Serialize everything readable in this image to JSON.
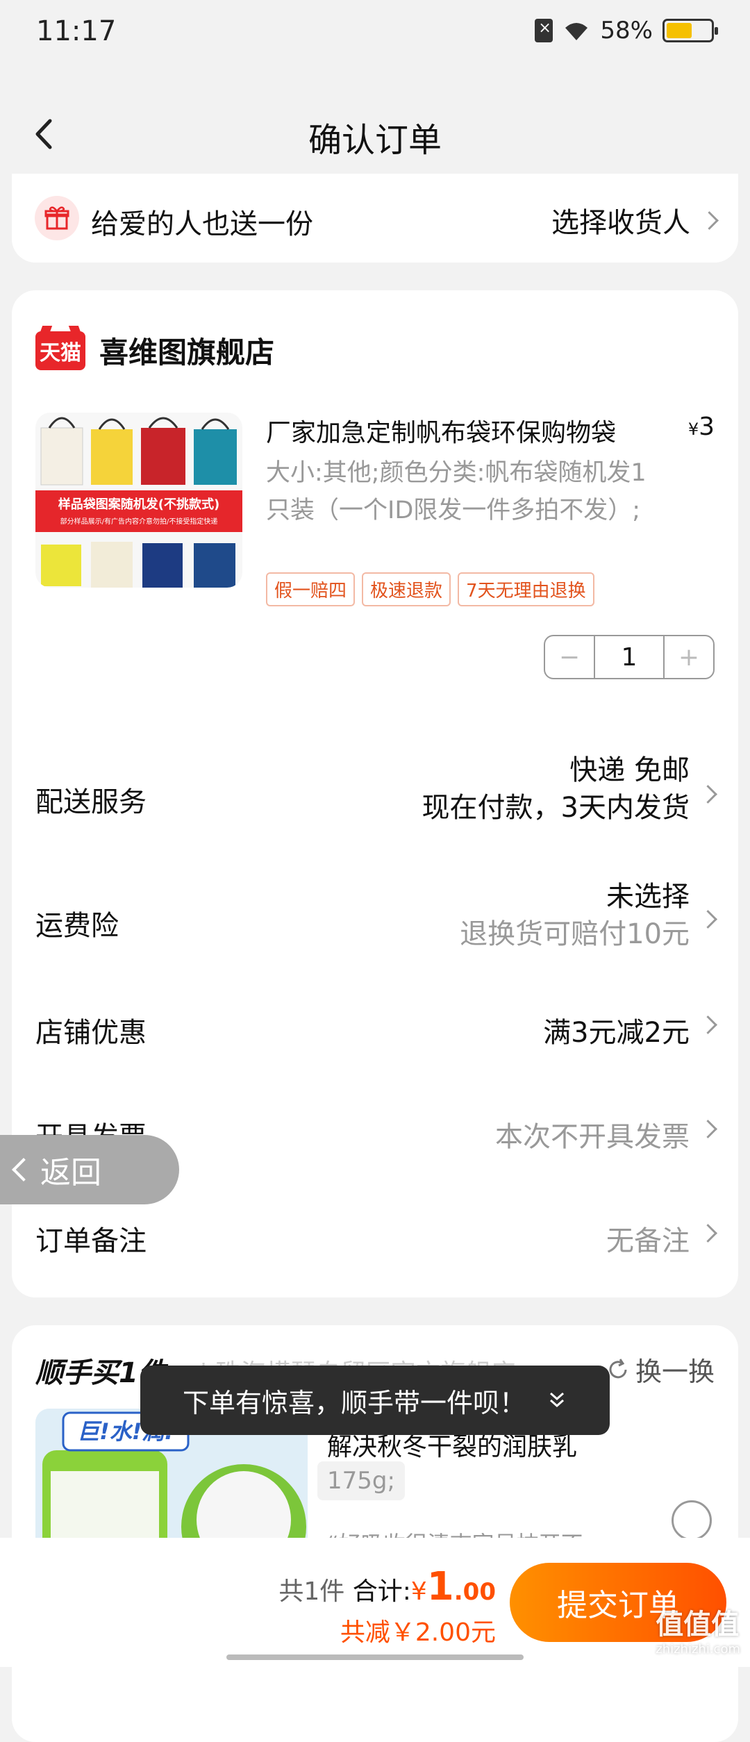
{
  "status": {
    "time": "11:17",
    "battery": "58%",
    "battery_level": 0.58
  },
  "nav": {
    "title": "确认订单"
  },
  "gift": {
    "text": "给爱的人也送一份",
    "action": "选择收货人"
  },
  "shop": {
    "badge": "天猫",
    "name": "喜维图旗舰店"
  },
  "product": {
    "title": "厂家加急定制帆布袋环保购物袋",
    "price_symbol": "¥",
    "price": "3",
    "spec": "大小:其他;颜色分类:帆布袋随机发1只装（一个ID限发一件多拍不发）;",
    "image_banner": "样品袋图案随机发(不挑款式)",
    "image_note": "部分样品展示/有广告内容介意勿拍/不接受指定快递",
    "tags": [
      "假一赔四",
      "极速退款",
      "7天无理由退换"
    ],
    "quantity": "1",
    "minus": "−",
    "plus": "+"
  },
  "rows": {
    "delivery": {
      "label": "配送服务",
      "value1": "快递 免邮",
      "value2": "现在付款，3天内发货"
    },
    "insurance": {
      "label": "运费险",
      "value1": "未选择",
      "value2": "退换货可赔付10元"
    },
    "discount": {
      "label": "店铺优惠",
      "value": "满3元减2元"
    },
    "invoice": {
      "label": "开具发票",
      "value": "本次不开具发票"
    },
    "note": {
      "label": "订单备注",
      "value": "无备注"
    }
  },
  "float_back": {
    "label": "返回"
  },
  "addon": {
    "title": "顺手买1件",
    "shop": "| 珠海横琴自贸区官方旗舰店",
    "refresh": "换一换",
    "desc": "解决秋冬干裂的润肤乳",
    "weight": "175g;",
    "review": "“好吸收很清爽容易抹开不",
    "img_text": "巨!水!润!"
  },
  "toast": {
    "text": "下单有惊喜，顺手带一件呗！",
    "icon": "double-chevron-down"
  },
  "bottom": {
    "count": "共1件",
    "total_label": "合计:",
    "yen": "¥",
    "amount_int": "1",
    "amount_dec": ".00",
    "saved": "共减￥2.00元",
    "submit": "提交订单"
  },
  "watermark": {
    "main": "值值值",
    "sub": "zhizhizhi.com"
  },
  "colors": {
    "accent": "#ff5000",
    "tag": "#e2531d",
    "tmall": "#e8262a"
  }
}
